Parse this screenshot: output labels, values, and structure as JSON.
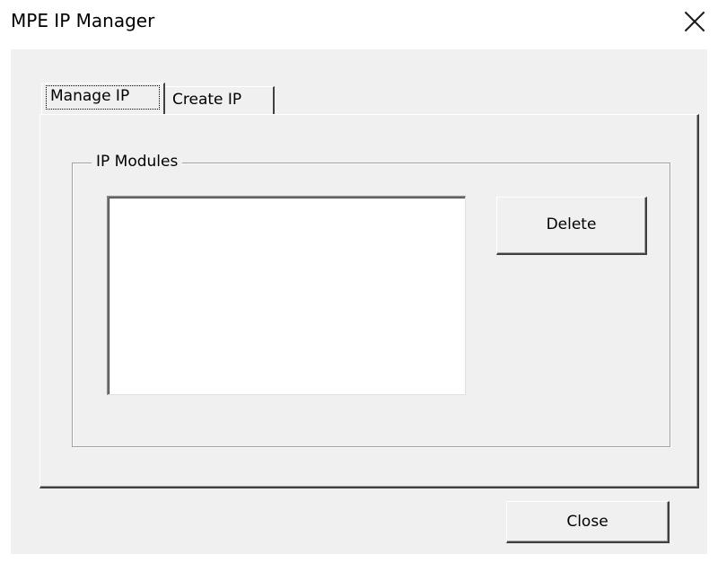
{
  "window": {
    "title": "MPE IP Manager"
  },
  "tabs": [
    {
      "label": "Manage IP",
      "selected": true
    },
    {
      "label": "Create IP",
      "selected": false
    }
  ],
  "manage_page": {
    "group_label": "IP Modules",
    "modules_list": [],
    "delete_label": "Delete"
  },
  "footer": {
    "close_label": "Close"
  },
  "icons": {
    "title_close": "close-icon"
  },
  "colors": {
    "dialog_bg": "#f0f0f0",
    "title_bg": "#ffffff",
    "listbox_bg": "#ffffff"
  }
}
